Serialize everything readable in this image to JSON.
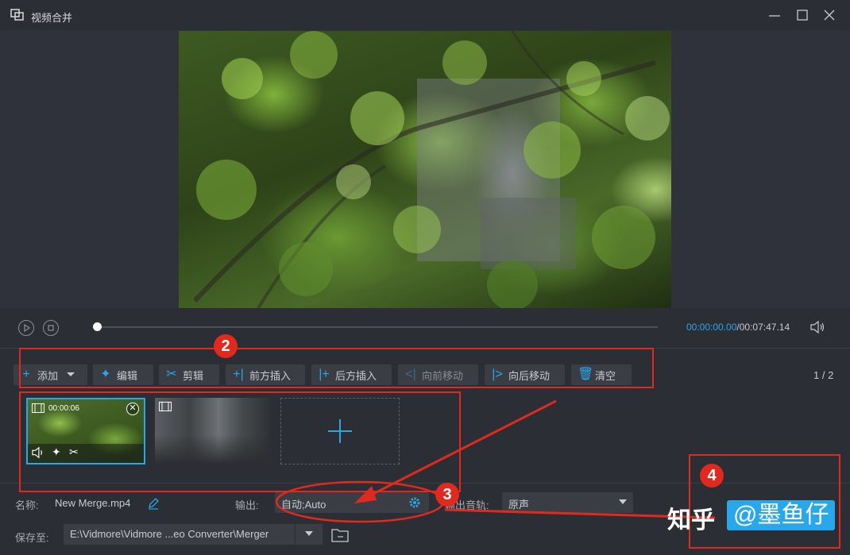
{
  "window": {
    "title": "视频合并",
    "icons": {
      "app": "merge-icon",
      "minimize": "minimize-icon",
      "maximize": "maximize-icon",
      "close": "close-icon"
    }
  },
  "player": {
    "current_time": "00:00:00.00",
    "separator": "/",
    "total_time": "00:07:47.14",
    "progress": 0.0
  },
  "toolbar": {
    "add": "添加",
    "edit": "编辑",
    "cut": "剪辑",
    "insert_before": "前方插入",
    "insert_after": "后方插入",
    "move_forward": "向前移动",
    "move_backward": "向后移动",
    "clear": "清空",
    "page_current": "1",
    "page_sep": "/",
    "page_total": "2"
  },
  "clips": [
    {
      "time": "00:00:06",
      "selected": true
    },
    {
      "time": "",
      "selected": false
    }
  ],
  "output": {
    "name_label": "名称:",
    "name_value": "New Merge.mp4",
    "output_label": "输出:",
    "output_value": "自动;Auto",
    "audio_label": "输出音轨:",
    "audio_value": "原声",
    "save_label": "保存至:",
    "save_path": "E:\\Vidmore\\Vidmore ...eo Converter\\Merger"
  },
  "annotations": {
    "badge2": "2",
    "badge3": "3",
    "badge4": "4",
    "color": "#e02a1f"
  },
  "watermark": {
    "site": "知乎",
    "author": "@墨鱼仔"
  },
  "colors": {
    "accent": "#2aa7ea",
    "background": "#2b2e34",
    "button": "#3a3d44"
  }
}
